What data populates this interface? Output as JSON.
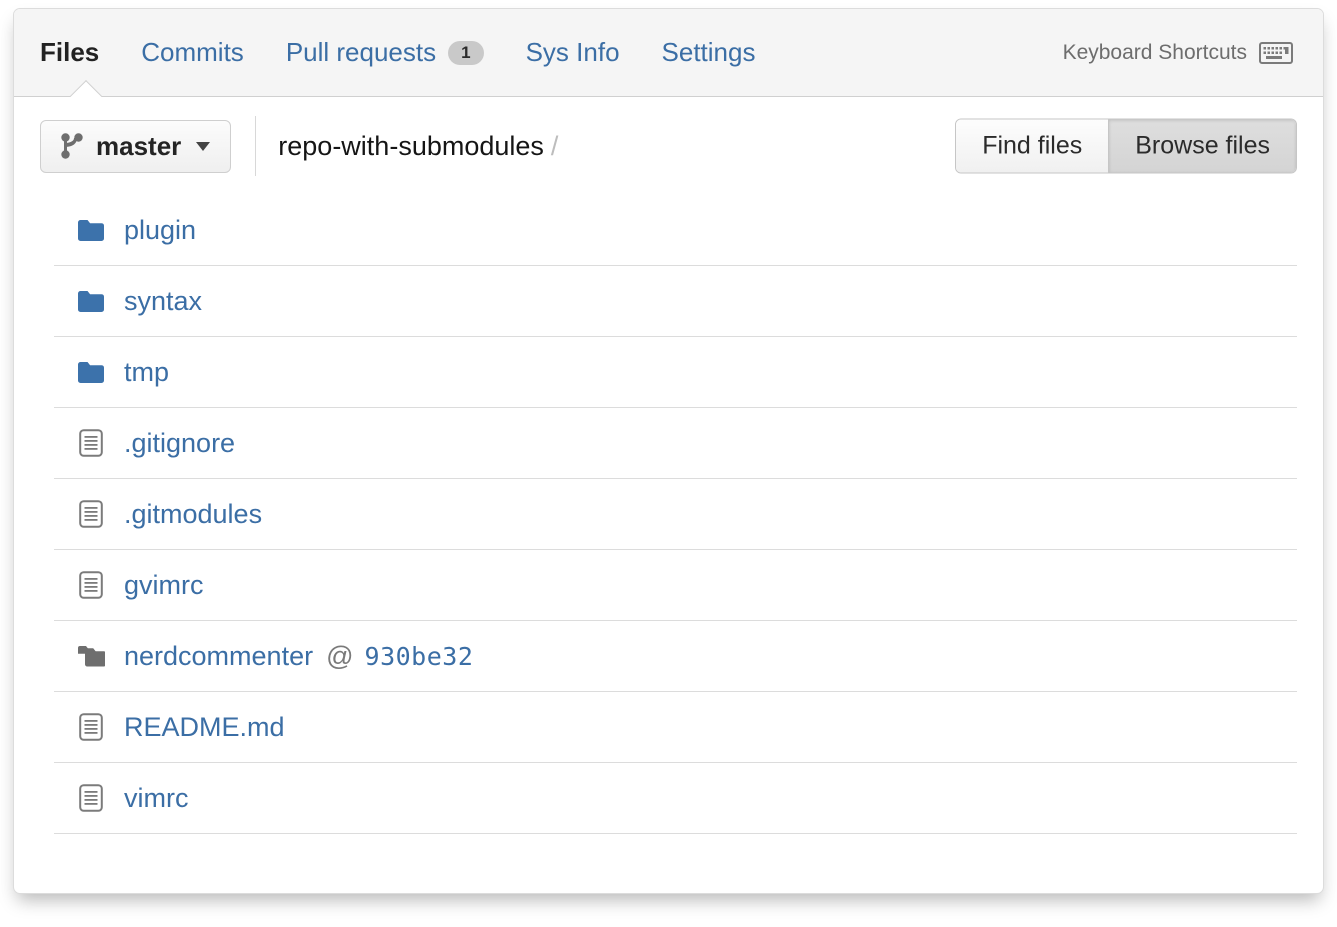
{
  "header": {
    "tabs": [
      {
        "label": "Files",
        "active": true,
        "badge": null,
        "name": "tab-files"
      },
      {
        "label": "Commits",
        "active": false,
        "badge": null,
        "name": "tab-commits"
      },
      {
        "label": "Pull requests",
        "active": false,
        "badge": "1",
        "name": "tab-pull-requests"
      },
      {
        "label": "Sys Info",
        "active": false,
        "badge": null,
        "name": "tab-sys-info"
      },
      {
        "label": "Settings",
        "active": false,
        "badge": null,
        "name": "tab-settings"
      }
    ],
    "keyboard_shortcuts_label": "Keyboard Shortcuts",
    "keyboard_shortcuts_icon": "keyboard-icon"
  },
  "toolbar": {
    "branch_icon": "git-branch-icon",
    "branch_name": "master",
    "branch_caret_icon": "chevron-down-icon",
    "breadcrumb_repo": "repo-with-submodules",
    "breadcrumb_separator": "/",
    "find_files_label": "Find files",
    "browse_files_label": "Browse files",
    "selected_view": "Browse files"
  },
  "files": [
    {
      "name": "plugin",
      "type": "folder",
      "icon": "folder-icon"
    },
    {
      "name": "syntax",
      "type": "folder",
      "icon": "folder-icon"
    },
    {
      "name": "tmp",
      "type": "folder",
      "icon": "folder-icon"
    },
    {
      "name": ".gitignore",
      "type": "file",
      "icon": "file-icon"
    },
    {
      "name": ".gitmodules",
      "type": "file",
      "icon": "file-icon"
    },
    {
      "name": "gvimrc",
      "type": "file",
      "icon": "file-icon"
    },
    {
      "name": "nerdcommenter",
      "type": "submodule",
      "icon": "submodule-icon",
      "at": "@",
      "sha": "930be32"
    },
    {
      "name": "README.md",
      "type": "file",
      "icon": "file-icon"
    },
    {
      "name": "vimrc",
      "type": "file",
      "icon": "file-icon"
    }
  ],
  "colors": {
    "link_blue": "#3b6ea5",
    "folder_blue": "#3c72ab",
    "icon_gray": "#757575",
    "header_bg": "#f5f5f5",
    "border": "#dcdcdc",
    "text_dark": "#222222"
  }
}
